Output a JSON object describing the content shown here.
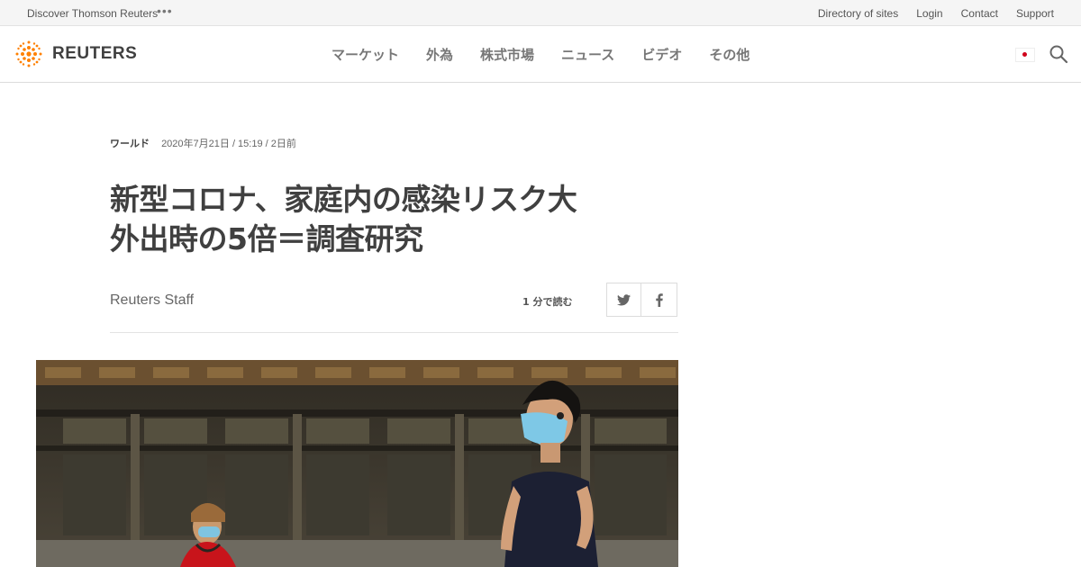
{
  "topbar": {
    "discover": "Discover Thomson Reuters",
    "links": [
      "Directory of sites",
      "Login",
      "Contact",
      "Support"
    ]
  },
  "header": {
    "brand": "REUTERS",
    "brand_color": "#ff8000",
    "nav": [
      "マーケット",
      "外為",
      "株式市場",
      "ニュース",
      "ビデオ",
      "その他"
    ],
    "icons": [
      "japan-flag-icon",
      "search-icon"
    ]
  },
  "article": {
    "section": "ワールド",
    "date": "2020年7月21日 / 15:19 / 2日前",
    "title_line1": "新型コロナ、家庭内の感染リスク大",
    "title_line2": "外出時の5倍＝調査研究",
    "author": "Reuters Staff",
    "read_time": "1 分で読む",
    "share": [
      "twitter-icon",
      "facebook-icon"
    ]
  }
}
